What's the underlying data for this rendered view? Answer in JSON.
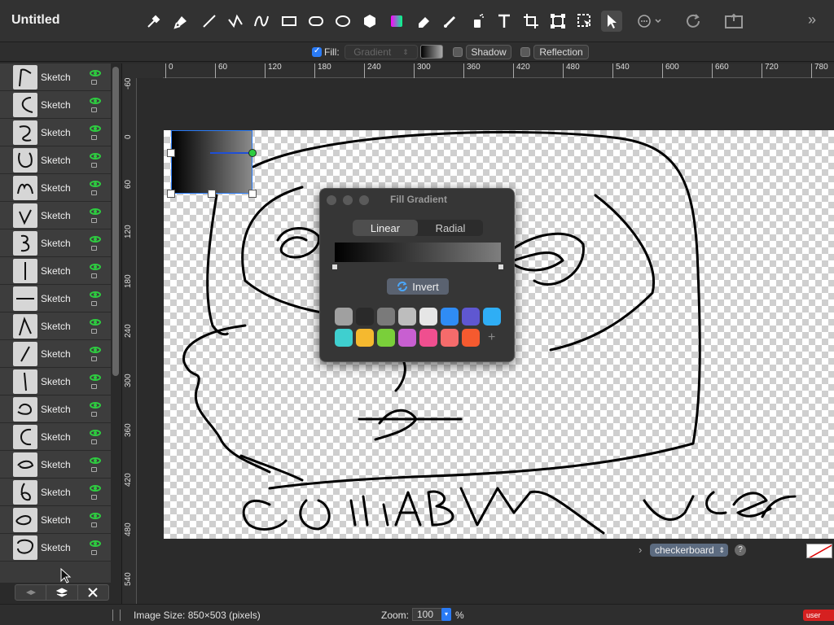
{
  "app": {
    "title": "Untitled"
  },
  "toolbar": {
    "tools": [
      "eyedropper-icon",
      "pen-tool-icon",
      "line-tool-icon",
      "polyline-icon",
      "curve-icon",
      "rectangle-icon",
      "rounded-rect-icon",
      "ellipse-icon",
      "polygon-icon",
      "color-fill-icon",
      "eraser-icon",
      "brush-icon",
      "spray-icon",
      "text-icon",
      "crop-icon",
      "transform-icon",
      "select-lasso-icon",
      "pointer-icon",
      "more-icon",
      "rotate-icon",
      "export-icon",
      "double-chevron-icon"
    ]
  },
  "options": {
    "fill_label": "Fill:",
    "fill_type": "Gradient",
    "shadow_label": "Shadow",
    "reflection_label": "Reflection"
  },
  "ruler": {
    "h_marks": [
      "0",
      "60",
      "120",
      "180",
      "240",
      "300",
      "360",
      "420",
      "480",
      "540",
      "600",
      "660",
      "720",
      "780"
    ],
    "v_marks": [
      "-60",
      "0",
      "60",
      "120",
      "180",
      "240",
      "300",
      "360",
      "420",
      "480",
      "540"
    ]
  },
  "layers": [
    {
      "name": "Sketch"
    },
    {
      "name": "Sketch"
    },
    {
      "name": "Sketch"
    },
    {
      "name": "Sketch"
    },
    {
      "name": "Sketch"
    },
    {
      "name": "Sketch"
    },
    {
      "name": "Sketch"
    },
    {
      "name": "Sketch"
    },
    {
      "name": "Sketch"
    },
    {
      "name": "Sketch"
    },
    {
      "name": "Sketch"
    },
    {
      "name": "Sketch"
    },
    {
      "name": "Sketch"
    },
    {
      "name": "Sketch"
    },
    {
      "name": "Sketch"
    },
    {
      "name": "Sketch"
    },
    {
      "name": "Sketch"
    },
    {
      "name": "Sketch"
    }
  ],
  "popover": {
    "title": "Fill Gradient",
    "tabs": [
      "Linear",
      "Radial"
    ],
    "active_tab": "Linear",
    "invert_label": "Invert",
    "swatches": [
      "#a0a0a0",
      "#2a2a2a",
      "#7a7a7a",
      "#bdbdbd",
      "#e6e6e6",
      "#2f8cf5",
      "#5f57d1",
      "#2faef5",
      "#3fcfcf",
      "#f5b92f",
      "#7acf3a",
      "#c85fd1",
      "#ef4f8f",
      "#f56b6b",
      "#f55a2f"
    ],
    "add_label": "+"
  },
  "background": {
    "mode": "checkerboard",
    "help": "?"
  },
  "status": {
    "image_size": "Image Size: 850×503 (pixels)",
    "zoom_label": "Zoom:",
    "zoom_value": "100",
    "zoom_unit": "%",
    "badge": "user"
  },
  "canvas": {
    "drawing_text": "COllABVM User"
  }
}
